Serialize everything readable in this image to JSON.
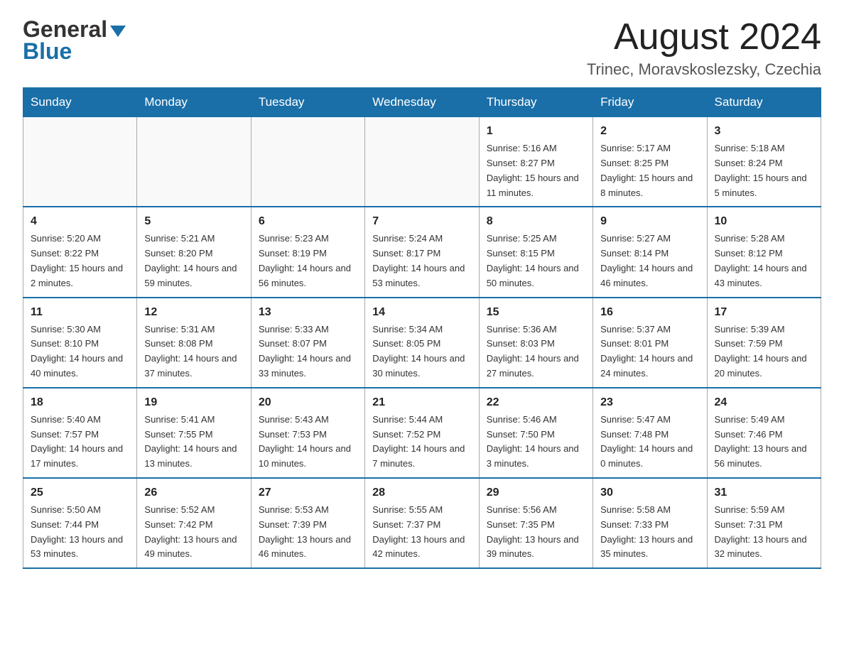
{
  "header": {
    "logo_general": "General",
    "logo_blue": "Blue",
    "main_title": "August 2024",
    "subtitle": "Trinec, Moravskoslezsky, Czechia"
  },
  "calendar": {
    "days_of_week": [
      "Sunday",
      "Monday",
      "Tuesday",
      "Wednesday",
      "Thursday",
      "Friday",
      "Saturday"
    ],
    "weeks": [
      [
        {
          "day": "",
          "info": ""
        },
        {
          "day": "",
          "info": ""
        },
        {
          "day": "",
          "info": ""
        },
        {
          "day": "",
          "info": ""
        },
        {
          "day": "1",
          "info": "Sunrise: 5:16 AM\nSunset: 8:27 PM\nDaylight: 15 hours and 11 minutes."
        },
        {
          "day": "2",
          "info": "Sunrise: 5:17 AM\nSunset: 8:25 PM\nDaylight: 15 hours and 8 minutes."
        },
        {
          "day": "3",
          "info": "Sunrise: 5:18 AM\nSunset: 8:24 PM\nDaylight: 15 hours and 5 minutes."
        }
      ],
      [
        {
          "day": "4",
          "info": "Sunrise: 5:20 AM\nSunset: 8:22 PM\nDaylight: 15 hours and 2 minutes."
        },
        {
          "day": "5",
          "info": "Sunrise: 5:21 AM\nSunset: 8:20 PM\nDaylight: 14 hours and 59 minutes."
        },
        {
          "day": "6",
          "info": "Sunrise: 5:23 AM\nSunset: 8:19 PM\nDaylight: 14 hours and 56 minutes."
        },
        {
          "day": "7",
          "info": "Sunrise: 5:24 AM\nSunset: 8:17 PM\nDaylight: 14 hours and 53 minutes."
        },
        {
          "day": "8",
          "info": "Sunrise: 5:25 AM\nSunset: 8:15 PM\nDaylight: 14 hours and 50 minutes."
        },
        {
          "day": "9",
          "info": "Sunrise: 5:27 AM\nSunset: 8:14 PM\nDaylight: 14 hours and 46 minutes."
        },
        {
          "day": "10",
          "info": "Sunrise: 5:28 AM\nSunset: 8:12 PM\nDaylight: 14 hours and 43 minutes."
        }
      ],
      [
        {
          "day": "11",
          "info": "Sunrise: 5:30 AM\nSunset: 8:10 PM\nDaylight: 14 hours and 40 minutes."
        },
        {
          "day": "12",
          "info": "Sunrise: 5:31 AM\nSunset: 8:08 PM\nDaylight: 14 hours and 37 minutes."
        },
        {
          "day": "13",
          "info": "Sunrise: 5:33 AM\nSunset: 8:07 PM\nDaylight: 14 hours and 33 minutes."
        },
        {
          "day": "14",
          "info": "Sunrise: 5:34 AM\nSunset: 8:05 PM\nDaylight: 14 hours and 30 minutes."
        },
        {
          "day": "15",
          "info": "Sunrise: 5:36 AM\nSunset: 8:03 PM\nDaylight: 14 hours and 27 minutes."
        },
        {
          "day": "16",
          "info": "Sunrise: 5:37 AM\nSunset: 8:01 PM\nDaylight: 14 hours and 24 minutes."
        },
        {
          "day": "17",
          "info": "Sunrise: 5:39 AM\nSunset: 7:59 PM\nDaylight: 14 hours and 20 minutes."
        }
      ],
      [
        {
          "day": "18",
          "info": "Sunrise: 5:40 AM\nSunset: 7:57 PM\nDaylight: 14 hours and 17 minutes."
        },
        {
          "day": "19",
          "info": "Sunrise: 5:41 AM\nSunset: 7:55 PM\nDaylight: 14 hours and 13 minutes."
        },
        {
          "day": "20",
          "info": "Sunrise: 5:43 AM\nSunset: 7:53 PM\nDaylight: 14 hours and 10 minutes."
        },
        {
          "day": "21",
          "info": "Sunrise: 5:44 AM\nSunset: 7:52 PM\nDaylight: 14 hours and 7 minutes."
        },
        {
          "day": "22",
          "info": "Sunrise: 5:46 AM\nSunset: 7:50 PM\nDaylight: 14 hours and 3 minutes."
        },
        {
          "day": "23",
          "info": "Sunrise: 5:47 AM\nSunset: 7:48 PM\nDaylight: 14 hours and 0 minutes."
        },
        {
          "day": "24",
          "info": "Sunrise: 5:49 AM\nSunset: 7:46 PM\nDaylight: 13 hours and 56 minutes."
        }
      ],
      [
        {
          "day": "25",
          "info": "Sunrise: 5:50 AM\nSunset: 7:44 PM\nDaylight: 13 hours and 53 minutes."
        },
        {
          "day": "26",
          "info": "Sunrise: 5:52 AM\nSunset: 7:42 PM\nDaylight: 13 hours and 49 minutes."
        },
        {
          "day": "27",
          "info": "Sunrise: 5:53 AM\nSunset: 7:39 PM\nDaylight: 13 hours and 46 minutes."
        },
        {
          "day": "28",
          "info": "Sunrise: 5:55 AM\nSunset: 7:37 PM\nDaylight: 13 hours and 42 minutes."
        },
        {
          "day": "29",
          "info": "Sunrise: 5:56 AM\nSunset: 7:35 PM\nDaylight: 13 hours and 39 minutes."
        },
        {
          "day": "30",
          "info": "Sunrise: 5:58 AM\nSunset: 7:33 PM\nDaylight: 13 hours and 35 minutes."
        },
        {
          "day": "31",
          "info": "Sunrise: 5:59 AM\nSunset: 7:31 PM\nDaylight: 13 hours and 32 minutes."
        }
      ]
    ]
  }
}
